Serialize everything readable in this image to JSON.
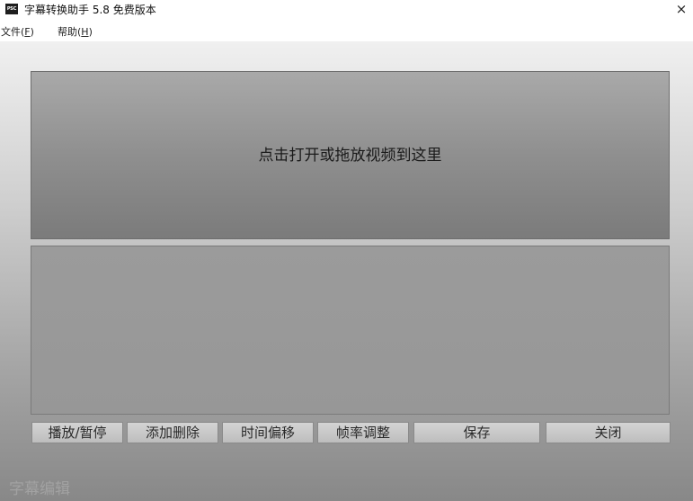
{
  "window": {
    "app_icon_text": "PSC",
    "title": "字幕转换助手 5.8 免费版本",
    "close_glyph": "×"
  },
  "menu": {
    "file_label": "文件",
    "file_open_paren": "(",
    "file_mnemonic": "F",
    "file_close_paren": ")",
    "help_label": "帮助",
    "help_open_paren": "(",
    "help_mnemonic": "H",
    "help_close_paren": ")"
  },
  "video_panel": {
    "prompt": "点击打开或拖放视频到这里"
  },
  "buttons": {
    "play_pause": "播放/暂停",
    "add_delete": "添加删除",
    "time_offset": "时间偏移",
    "frame_rate": "帧率调整",
    "save": "保存",
    "close": "关闭"
  },
  "footer": {
    "label": "字幕编辑"
  }
}
